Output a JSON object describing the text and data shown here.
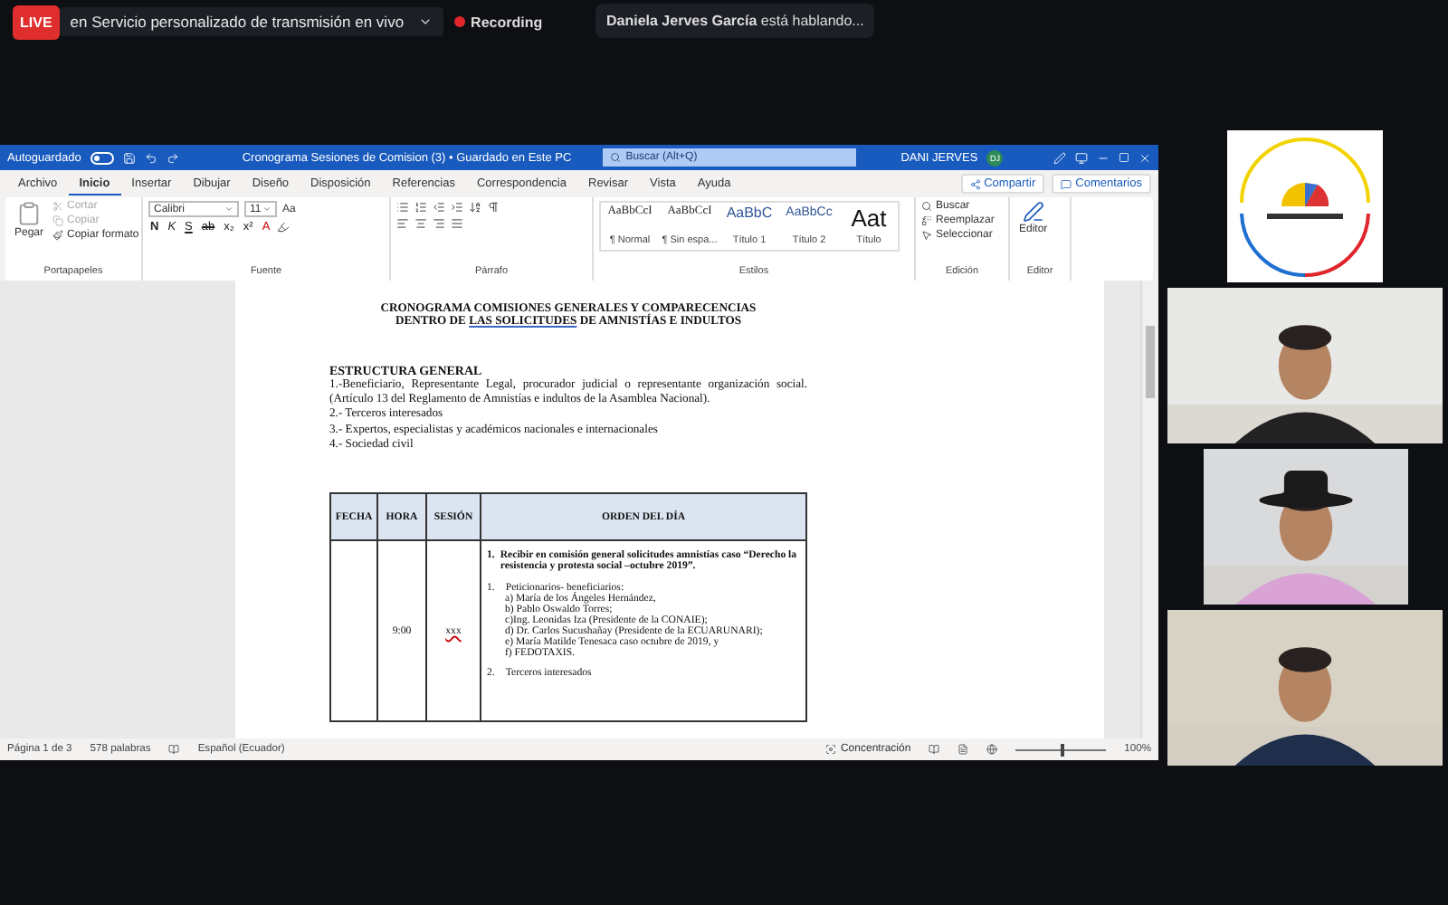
{
  "top_bar": {
    "live_badge": "LIVE",
    "stream_label": "en Servicio personalizado de transmisión en vivo",
    "recording": "Recording",
    "speaker": "**Daniela Jerves García** está hablando..."
  },
  "word": {
    "title_bar": {
      "autosave_label": "Autoguardado",
      "autosave_on": false,
      "title": "Cronograma Sesiones de Comision (3) • Guardado en Este PC",
      "search_placeholder": "Buscar (Alt+Q)",
      "user": "DANI JERVES",
      "avatar": "DJ"
    },
    "ribbon_tabs": [
      {
        "label": "Archivo",
        "selected": false
      },
      {
        "label": "Inicio",
        "selected": true
      },
      {
        "label": "Insertar",
        "selected": false
      },
      {
        "label": "Dibujar",
        "selected": false
      },
      {
        "label": "Diseño",
        "selected": false
      },
      {
        "label": "Disposición",
        "selected": false
      },
      {
        "label": "Referencias",
        "selected": false
      },
      {
        "label": "Correspondencia",
        "selected": false
      },
      {
        "label": "Revisar",
        "selected": false
      },
      {
        "label": "Vista",
        "selected": false
      },
      {
        "label": "Ayuda",
        "selected": false
      }
    ],
    "share": "Compartir",
    "comments": "Comentarios",
    "clipboard": {
      "label": "Portapapeles",
      "paste": "Pegar",
      "items": [
        {
          "text": "Cortar",
          "disabled": true
        },
        {
          "text": "Copiar",
          "disabled": true
        },
        {
          "text": "Copiar formato",
          "disabled": false
        }
      ]
    },
    "font": {
      "label": "Fuente",
      "name": "Calibri",
      "size": "11",
      "case_button": "Aa",
      "buttons": [
        {
          "text": "N",
          "kind": "bold"
        },
        {
          "text": "K",
          "kind": "italic"
        },
        {
          "text": "S",
          "kind": "underline"
        },
        {
          "text": "ab",
          "kind": "strike"
        },
        {
          "text": "x₂",
          "kind": "sub"
        },
        {
          "text": "x²",
          "kind": "sup"
        },
        {
          "text": "A",
          "kind": "color"
        }
      ]
    },
    "paragraph": {
      "label": "Párrafo"
    },
    "styles": {
      "label": "Estilos",
      "items": [
        {
          "preview": "AaBbCcI",
          "name": "¶ Normal",
          "kind": "normal"
        },
        {
          "preview": "AaBbCcI",
          "name": "¶ Sin espa...",
          "kind": "normal"
        },
        {
          "preview": "AaBbC",
          "name": "Título 1",
          "kind": "heading1"
        },
        {
          "preview": "AaBbCc",
          "name": "Título 2",
          "kind": "heading2"
        },
        {
          "preview": "Aat",
          "name": "Título",
          "kind": "title"
        }
      ]
    },
    "editing": {
      "label": "Edición",
      "items": [
        "Buscar",
        "Reemplazar",
        "Seleccionar"
      ]
    },
    "editor": {
      "label": "Editor",
      "button": "Editor"
    },
    "document": {
      "heading_line1": "CRONOGRAMA COMISIONES GENERALES Y COMPARECENCIAS",
      "heading_line2": {
        "before": "DENTRO DE ",
        "underlined": "LAS  SOLICITUDES",
        "after": " DE AMNISTÍAS E INDULTOS"
      },
      "section_title": "ESTRUCTURA GENERAL",
      "paragraphs": [
        "1.-Beneficiario, Representante Legal, procurador judicial o representante organización social. (Artículo 13  del Reglamento de Amnistías e indultos de la Asamblea Nacional).",
        "2.- Terceros interesados",
        "3.- Expertos, especialistas y académicos nacionales e internacionales",
        "4.- Sociedad civil"
      ],
      "table": {
        "columns": [
          "FECHA",
          "HORA",
          "SESIÓN",
          "ORDEN DEL DÍA"
        ],
        "row": {
          "time": "9:00",
          "session": "xxx",
          "agenda": {
            "number": "1.",
            "heading": "Recibir en comisión general solicitudes amnistías caso “Derecho la resistencia y protesta social –octubre 2019”.",
            "list": [
              {
                "number": "1.",
                "text": "Peticionarios- beneficiarios:",
                "items": [
                  "a) María de los Ángeles Hernández,",
                  "b) Pablo Oswaldo Torres;",
                  "c)Ing. Leonidas Iza (Presidente de la CONAIE);",
                  "d) Dr. Carlos Sucushañay (Presidente de la ECUARUNARI);",
                  "e) María Matilde Tenesaca caso octubre de 2019, y",
                  "f) FEDOTAXIS."
                ]
              },
              {
                "number": "2.",
                "text": "Terceros interesados"
              }
            ]
          }
        }
      }
    },
    "status_bar": {
      "page": "Página 1 de 3",
      "words": "578 palabras",
      "language": "Español (Ecuador)",
      "focus": "Concentración",
      "zoom": "100%",
      "zoom_slider": {
        "level": 0.5
      }
    }
  }
}
